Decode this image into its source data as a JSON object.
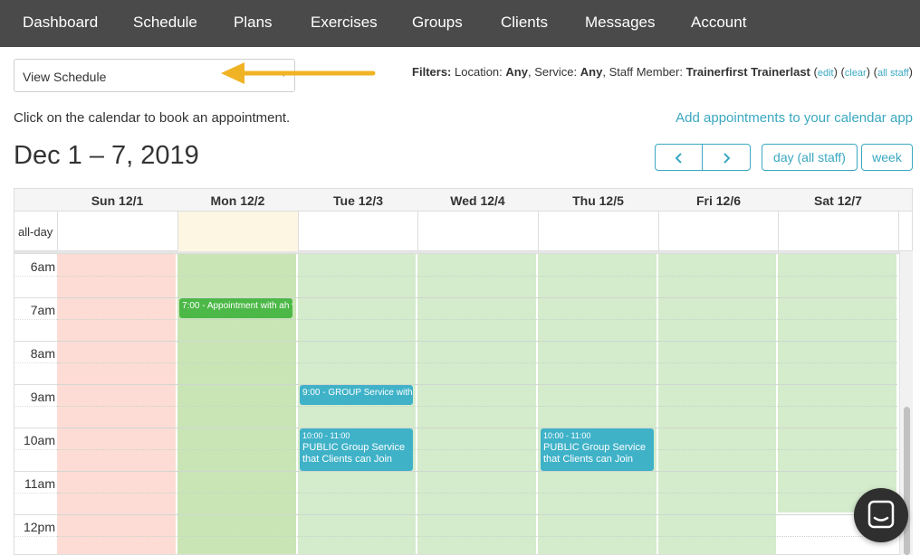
{
  "nav": {
    "items": [
      "Dashboard",
      "Schedule",
      "Plans",
      "Exercises",
      "Groups",
      "Clients",
      "Messages",
      "Account"
    ]
  },
  "view_select": {
    "value": "View Schedule"
  },
  "filters": {
    "label": "Filters:",
    "location_label": "Location:",
    "location_value": "Any",
    "service_label": "Service:",
    "service_value": "Any",
    "staff_label": "Staff Member:",
    "staff_value": "Trainerfirst Trainerlast",
    "edit": "edit",
    "clear": "clear",
    "all_staff": "all staff"
  },
  "hint": "Click on the calendar to book an appointment.",
  "calendar_app_link": "Add appointments to your calendar app",
  "date_range": "Dec 1 – 7, 2019",
  "buttons": {
    "prev": "‹",
    "next": "›",
    "day_all_staff": "day (all staff)",
    "week": "week"
  },
  "calendar": {
    "days": [
      "Sun 12/1",
      "Mon 12/2",
      "Tue 12/3",
      "Wed 12/4",
      "Thu 12/5",
      "Fri 12/6",
      "Sat 12/7"
    ],
    "allday_label": "all-day",
    "times": [
      "6am",
      "7am",
      "8am",
      "9am",
      "10am",
      "11am",
      "12pm"
    ],
    "events": [
      {
        "time": "7:00",
        "title": "Appointment with ah wh"
      },
      {
        "time": "9:00",
        "title": "GROUP Service with Wo"
      },
      {
        "time": "10:00 - 11:00",
        "title": "PUBLIC Group Service that Clients can Join"
      },
      {
        "time": "10:00 - 11:00",
        "title": "PUBLIC Group Service that Clients can Join"
      }
    ]
  },
  "colors": {
    "nav_bg": "#4a4a4a",
    "accent": "#3aa8c1",
    "closed_day": "#fddcd6",
    "available": "#d4ebcc",
    "today": "#c9e5b6",
    "today_allday": "#fdf6e3",
    "event_green": "#4cb847",
    "event_teal": "#3fb2c8",
    "arrow": "#f0b323"
  },
  "icons": {
    "chat": "chat-bubble-icon",
    "caret": "caret-down-icon"
  }
}
